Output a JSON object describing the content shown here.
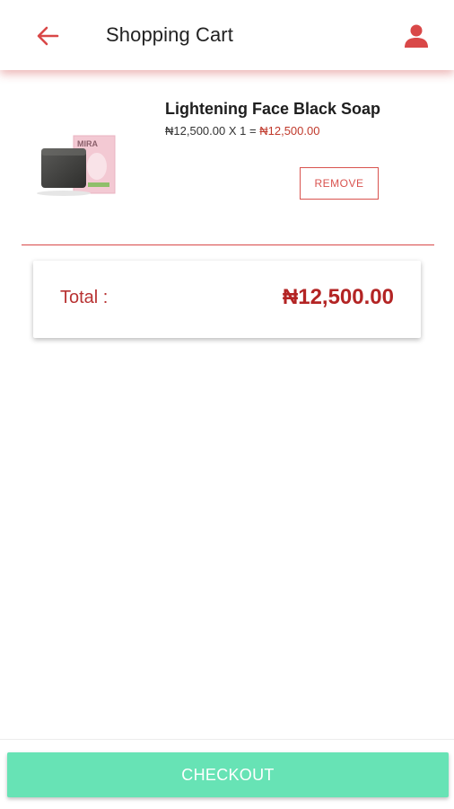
{
  "header": {
    "title": "Shopping Cart",
    "back_icon": "arrow-left-icon",
    "profile_icon": "user-icon"
  },
  "cart": {
    "items": [
      {
        "name": "Lightening Face Black Soap",
        "unit_price": "₦12,500.00",
        "multiplier": "X",
        "quantity": "1",
        "equals": "=",
        "line_total": "₦12,500.00",
        "remove_label": "REMOVE",
        "image_brand": "MIRA"
      }
    ]
  },
  "summary": {
    "total_label": "Total :",
    "total_amount": "₦12,500.00"
  },
  "footer": {
    "checkout_label": "CHECKOUT"
  },
  "colors": {
    "accent": "#d94848",
    "price_red": "#b32424",
    "checkout_green": "#67e3b5"
  }
}
